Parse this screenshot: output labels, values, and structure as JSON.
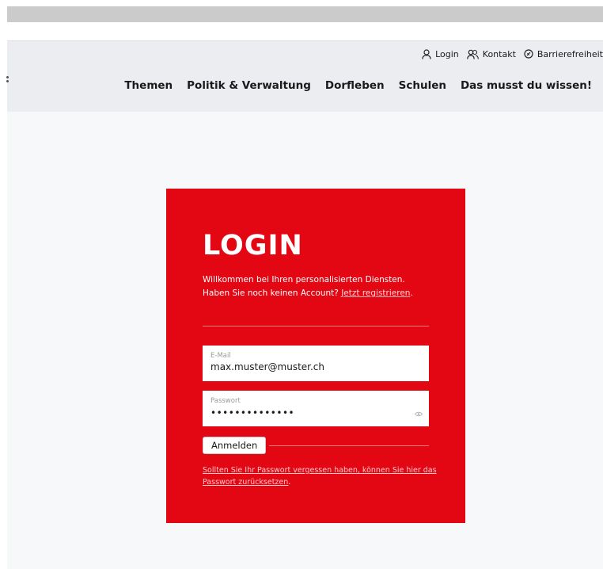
{
  "header": {
    "utility_nav": [
      {
        "label": "Login",
        "icon": "user-icon"
      },
      {
        "label": "Kontakt",
        "icon": "users-icon"
      },
      {
        "label": "Barrierefreiheit",
        "icon": "accessibility-icon"
      }
    ],
    "main_nav": [
      "Themen",
      "Politik & Verwaltung",
      "Dorfleben",
      "Schulen",
      "Das musst du wissen!"
    ]
  },
  "login": {
    "title": "LOGIN",
    "intro_text": "Willkommen bei Ihren personalisierten Diensten. Haben Sie noch keinen Account?",
    "register_link": "Jetzt registrieren",
    "intro_end": ".",
    "email_label": "E-Mail",
    "email_value": "max.muster@muster.ch",
    "password_label": "Passwort",
    "password_masked": "••••••••••••••",
    "submit_label": "Anmelden",
    "forgot_link": "Sollten Sie Ihr Passwort vergessen haben, können Sie hier das Passwort zurücksetzen",
    "forgot_end": "."
  },
  "colors": {
    "brand_red": "#e30613",
    "header_bg": "#ebedf0",
    "page_bg": "#f7f8fa"
  }
}
